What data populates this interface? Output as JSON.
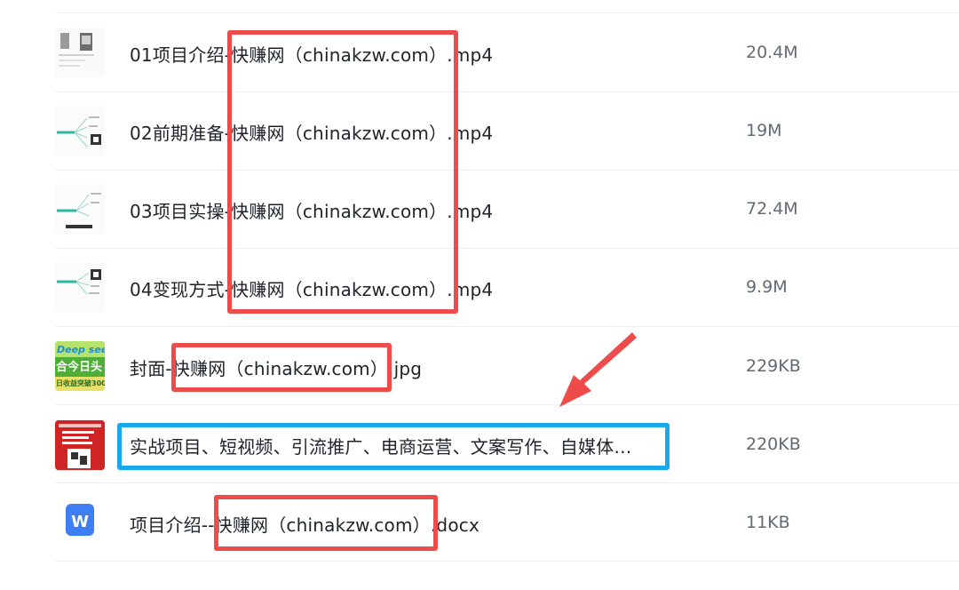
{
  "files": [
    {
      "name": "01项目介绍-快赚网（chinakzw.com）.mp4",
      "size": "20.4M",
      "thumb": "video-thumb-icon"
    },
    {
      "name": "02前期准备-快赚网（chinakzw.com）.mp4",
      "size": "19M",
      "thumb": "mindmap-thumb-icon"
    },
    {
      "name": "03项目实操-快赚网（chinakzw.com）.mp4",
      "size": "72.4M",
      "thumb": "mindmap-thumb-icon"
    },
    {
      "name": "04变现方式-快赚网（chinakzw.com）.mp4",
      "size": "9.9M",
      "thumb": "mindmap-thumb-icon"
    },
    {
      "name": "封面-快赚网（chinakzw.com）.jpg",
      "size": "229KB",
      "thumb": "cover-image-icon"
    },
    {
      "name": "实战项目、短视频、引流推广、电商运营、文案写作、自媒体…",
      "size": "220KB",
      "thumb": "promo-image-icon"
    },
    {
      "name": "项目介绍--快赚网（chinakzw.com）.docx",
      "size": "11KB",
      "thumb": "word-doc-icon"
    }
  ],
  "thumb_text": {
    "cover_line1": "Deep seek",
    "cover_line2": "合今日头",
    "cover_line3": "日收益突破300",
    "word_letter": "W"
  },
  "colors": {
    "highlight_red": "#ee4b4b",
    "highlight_blue": "#1aa8ec",
    "arrow": "#ee4b4b",
    "word_blue": "#3d7ef2"
  }
}
